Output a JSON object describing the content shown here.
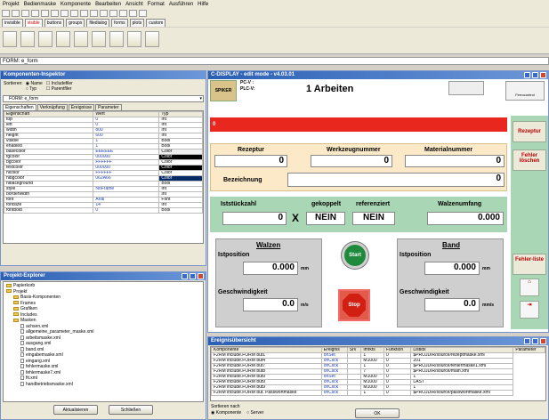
{
  "menubar": [
    "Projekt",
    "Bedienmaske",
    "Komponente",
    "Bearbeiten",
    "Ansicht",
    "Format",
    "Ausführen",
    "Hilfe"
  ],
  "tabs": [
    {
      "label": "invisible",
      "active": false
    },
    {
      "label": "visible",
      "active": true
    },
    {
      "label": "buttons",
      "active": false
    },
    {
      "label": "groups",
      "active": false
    },
    {
      "label": "filedialog",
      "active": false
    },
    {
      "label": "forms",
      "active": false
    },
    {
      "label": "plots",
      "active": false
    },
    {
      "label": "custom",
      "active": false
    }
  ],
  "form_path": "FORM: e_form",
  "inspector": {
    "title": "Komponenten-Inspektor",
    "sort_label": "Sortieren:",
    "sort_options": [
      "Name",
      "Typ",
      "Includefiler",
      "Parentfiler"
    ],
    "selected_form": "FORM: e_form",
    "tabs": [
      "Eigenschaften",
      "Verknüpfung",
      "Ereignisse",
      "Parameter"
    ],
    "columns": [
      "Eigenschaft",
      "Wert",
      "Typ"
    ],
    "rows": [
      [
        "top",
        "0",
        "Int"
      ],
      [
        "left",
        "0",
        "Int"
      ],
      [
        "width",
        "800",
        "Int"
      ],
      [
        "height",
        "600",
        "Int"
      ],
      [
        "visible",
        "1",
        "Bool"
      ],
      [
        "enabled",
        "1",
        "Bool"
      ],
      [
        "basecolor",
        "EEEEEE",
        "Color"
      ],
      [
        "fgcolor",
        "000000",
        "Color"
      ],
      [
        "bgcolor",
        "FFFFFF",
        "Color"
      ],
      [
        "textcolor",
        "000000",
        "Color"
      ],
      [
        "hlcolor",
        "FFFFFF",
        "Color"
      ],
      [
        "hlbgcolor",
        "062A66",
        "Color"
      ],
      [
        "hlbackground",
        "",
        "Bool"
      ],
      [
        "style",
        "NoFrame",
        "Int"
      ],
      [
        "borderwidth",
        "",
        "Int"
      ],
      [
        "font",
        "Arial",
        "Font"
      ],
      [
        "fontsize",
        "14",
        "Int"
      ],
      [
        "fontbold",
        "0",
        "Bool"
      ]
    ]
  },
  "explorer": {
    "title": "Projekt-Explorer",
    "items": [
      {
        "label": "Papierkorb",
        "indent": 0,
        "kind": "folder"
      },
      {
        "label": "Projekt",
        "indent": 0,
        "kind": "folder"
      },
      {
        "label": "Basis-Komponenten",
        "indent": 1,
        "kind": "folder"
      },
      {
        "label": "Frames",
        "indent": 1,
        "kind": "folder"
      },
      {
        "label": "Grafiken",
        "indent": 1,
        "kind": "folder"
      },
      {
        "label": "Includes",
        "indent": 1,
        "kind": "folder"
      },
      {
        "label": "Masken",
        "indent": 1,
        "kind": "folder"
      },
      {
        "label": "achsen.xml",
        "indent": 2,
        "kind": "file"
      },
      {
        "label": "allgemeine_parameter_maske.xml",
        "indent": 2,
        "kind": "file"
      },
      {
        "label": "arbeitsmaske.xml",
        "indent": 2,
        "kind": "file"
      },
      {
        "label": "ausgang.xml",
        "indent": 2,
        "kind": "file"
      },
      {
        "label": "band.xml",
        "indent": 2,
        "kind": "file"
      },
      {
        "label": "eingabemaske.xml",
        "indent": 2,
        "kind": "file"
      },
      {
        "label": "eingang.xml",
        "indent": 2,
        "kind": "file"
      },
      {
        "label": "fehlermaske.xml",
        "indent": 2,
        "kind": "file"
      },
      {
        "label": "fehlermaske7.xml",
        "indent": 2,
        "kind": "file"
      },
      {
        "label": "fit.xml",
        "indent": 2,
        "kind": "file"
      },
      {
        "label": "handbetriebsmaske.xml",
        "indent": 2,
        "kind": "file"
      }
    ],
    "btn_update": "Aktualisieren",
    "btn_close": "Schließen"
  },
  "editor": {
    "title": "C-DISPLAY - edit mode - v4.03.01",
    "plc_v": "PC-V :",
    "plc_v2": "PLC-V:",
    "logo": "SPIKER",
    "heading": "1 Arbeiten",
    "ferro": "Ferrocontrol",
    "red_bar_value": "0",
    "rezeptur_label": "Rezeptur",
    "rezeptur_value": "0",
    "werkzeug_label": "Werkzeugnummer",
    "werkzeug_value": "0",
    "material_label": "Materialnummer",
    "material_value": "0",
    "bezeichnung_label": "Bezeichnung",
    "bezeichnung_value": "0",
    "iststueck_label": "Iststückzahl",
    "iststueck_value": "0",
    "x_label": "X",
    "gekoppelt_label": "gekoppelt",
    "gekoppelt_value": "NEIN",
    "referenziert_label": "referenziert",
    "referenziert_value": "NEIN",
    "walzenumfang_label": "Walzenumfang",
    "walzenumfang_value": "0.000",
    "walzen_title": "Walzen",
    "band_title": "Band",
    "istposition": "Istposition",
    "walzen_pos": "0.000",
    "band_pos": "0.000",
    "mm": "mm",
    "geschw": "Geschwindigkeit",
    "walzen_speed": "0.0",
    "band_speed": "0.0",
    "mps": "m/s",
    "mms": "mm/s",
    "start": "Start",
    "stop": "Stop",
    "side": [
      "Rezeptur",
      "Fehler löschen",
      "Fehler-liste"
    ]
  },
  "events": {
    "title": "Ereignisübersicht",
    "columns": [
      "Komponente",
      "Ereignis",
      "Srv",
      "Imfkts",
      "Funktion",
      "Listidx",
      "Parameter"
    ],
    "rows": [
      [
        "F2RM include.FORM but1",
        "onSet",
        "",
        "1",
        "0",
        "$PROJDIR/source/rezeptmaske.xml"
      ],
      [
        "F2RM include.FORM but4",
        "onClick",
        "",
        "M1000",
        "0",
        "201"
      ],
      [
        "F2RM include.FORM but7",
        "onClick",
        "",
        "1",
        "0",
        "$PROJDIR/source/fehlermaske1.xml"
      ],
      [
        "F2RM include.FORM but8",
        "onClick",
        "",
        "7",
        "0",
        "$PROJDIR/source/main.xml"
      ],
      [
        "F2RM include.FORM but9",
        "onSet",
        "",
        "M1000",
        "0",
        "1"
      ],
      [
        "F2RM include.FORM but9",
        "onClick",
        "",
        "M1000",
        "0",
        "LAST"
      ],
      [
        "F2RM include.FORM but9",
        "onClick",
        "",
        "M1000",
        "0",
        "1"
      ],
      [
        "F2RM include.FORM but. Passwortmaske",
        "onClick",
        "",
        "1",
        "0",
        "$PROJDIR/source/passwortmaske.xml"
      ]
    ],
    "sort_label": "Sortieren nach",
    "sort_options": [
      "Komponente",
      "Server"
    ],
    "ok": "OK"
  },
  "colors": {
    "accent": "#2b5fb4",
    "panel_green": "#a9d6b4",
    "red_bar": "#e8281e"
  }
}
